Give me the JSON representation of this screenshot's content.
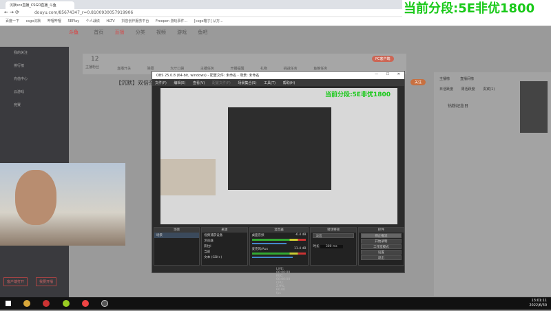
{
  "browser": {
    "tab_title": "沉默scx直播_CSGO直播_斗鱼",
    "url": "douyu.com/85674347_r=0.8100930057919906",
    "bookmarks": [
      "百度一下",
      "csgo沉默",
      "哔哩哔哩",
      "5EPlay",
      "个人战绩",
      "HLTV",
      "抖音创作服务平台",
      "Freepen 游玩事件...",
      "[csgo箱子] 从万..."
    ]
  },
  "overlay_text": "当前分段:5E非优1800",
  "site": {
    "nav": [
      "首页",
      "直播",
      "分类",
      "视频",
      "游戏",
      "鱼吧"
    ],
    "sidebar": [
      "我的关注",
      "排行榜",
      "充值中心",
      "云游戏",
      "竞赛"
    ],
    "stats_count": "12",
    "stats_label": "主播粉丝",
    "stats_items": [
      "直播开关",
      "弹幕",
      "大厅口袋",
      "主播任务",
      "开播提醒",
      "礼物",
      "挑战任务",
      "鱼粮任务",
      "PC客户端"
    ],
    "room_title": "【沉默】双倍奈...",
    "follow": "关注",
    "rank_tabs": [
      "主播榜",
      "直播间榜"
    ],
    "right_items": [
      "日活跃度",
      "周活跃度",
      "贵宾(1)"
    ],
    "event": "钻粉纪念日",
    "client_btn": "客户端打开",
    "live_btn": "我要开播"
  },
  "obs": {
    "title": "OBS 25.0.8 (64-bit, windows) - 配置文件: 未命名 - 场景: 未命名",
    "menu": [
      "文件(F)",
      "编辑(E)",
      "查看(V)",
      "配置文件(P)",
      "场景集合(S)",
      "工具(T)",
      "帮助(H)"
    ],
    "docks": {
      "scenes": "场景",
      "sources": "来源",
      "mixer": "混音器",
      "transitions": "转场特效",
      "controls": "控件"
    },
    "scene_items": [
      "场景"
    ],
    "source_items": [
      "视频捕获设备",
      "浏览器",
      "影拉I",
      "当前",
      "文本 (GDI+)"
    ],
    "mixer": [
      {
        "name": "桌面音频",
        "level": "-6.4 dB"
      },
      {
        "name": "麦克风/Aux",
        "level": "11.4 dB"
      }
    ],
    "transition": "淡出",
    "duration_label": "时长",
    "duration": "300 ms",
    "controls": [
      "停止推流",
      "开始录制",
      "工作室模式",
      "设置",
      "退出"
    ],
    "status": "LIVE: 00:00:00  REC: 00:00:00  CPU: 2.9%, 60.00 fps"
  },
  "taskbar": {
    "time": "13:01:11",
    "date": "2022/6/30"
  },
  "colors": {
    "overlay_green": "#19c919",
    "brand_orange": "#ff7700"
  }
}
